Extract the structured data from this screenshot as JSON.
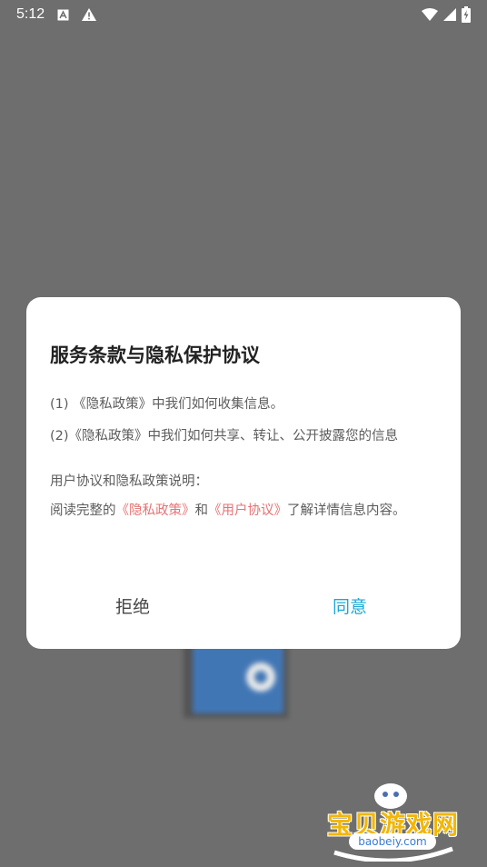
{
  "status_bar": {
    "time": "5:12",
    "icons": [
      "a-box-icon",
      "alert-triangle-icon"
    ],
    "right_icons": [
      "wifi-icon",
      "signal-icon",
      "battery-charging-icon"
    ]
  },
  "dialog": {
    "title": "服务条款与隐私保护协议",
    "line1": "(1) 《隐私政策》中我们如何收集信息。",
    "line2": "(2)《隐私政策》中我们如何共享、转让、公开披露您的信息",
    "section_label": "用户协议和隐私政策说明：",
    "paragraph": {
      "prefix": "阅读完整的",
      "link1": "《隐私政策》",
      "middle": "和",
      "link2": "《用户协议》",
      "suffix": "了解详情信息内容。"
    },
    "reject_label": "拒绝",
    "agree_label": "同意"
  },
  "watermark": {
    "brand": "宝贝游戏网",
    "url": "baobeiy.com"
  },
  "colors": {
    "overlay": "#6e6e6e",
    "link": "#e57373",
    "agree": "#1aa8d4"
  }
}
